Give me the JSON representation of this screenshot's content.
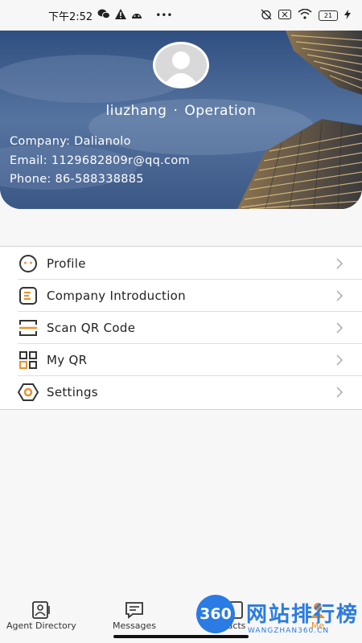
{
  "status_bar": {
    "time": "下午2:52",
    "battery": "21"
  },
  "profile": {
    "username": "liuzhang",
    "separator": "·",
    "role": "Operation",
    "company": "Company: Dalianolo",
    "email": "Email: 1129682809r@qq.com",
    "phone": "Phone: 86-588338885"
  },
  "menu": {
    "items": [
      {
        "label": "Profile",
        "icon": "face-icon"
      },
      {
        "label": "Company Introduction",
        "icon": "document-icon"
      },
      {
        "label": "Scan QR Code",
        "icon": "scan-icon"
      },
      {
        "label": "My QR",
        "icon": "qr-code-icon"
      },
      {
        "label": "Settings",
        "icon": "gear-icon"
      }
    ]
  },
  "tabbar": {
    "tabs": [
      {
        "label": "Agent Directory",
        "icon": "contact-card-icon"
      },
      {
        "label": "Messages",
        "icon": "chat-icon"
      },
      {
        "label": "Contacts",
        "icon": "contacts-icon"
      },
      {
        "label": "Me",
        "icon": "me-icon"
      }
    ],
    "visible_contacts_label": "acts",
    "visible_me_label": "Me"
  },
  "watermark": {
    "badge": "360",
    "title": "网站排行榜",
    "subtitle": "WANGZHAN360.CN"
  },
  "colors": {
    "accent_orange": "#e8912e",
    "header_blue": "#4a6a98",
    "watermark_blue": "#2b7be4"
  }
}
